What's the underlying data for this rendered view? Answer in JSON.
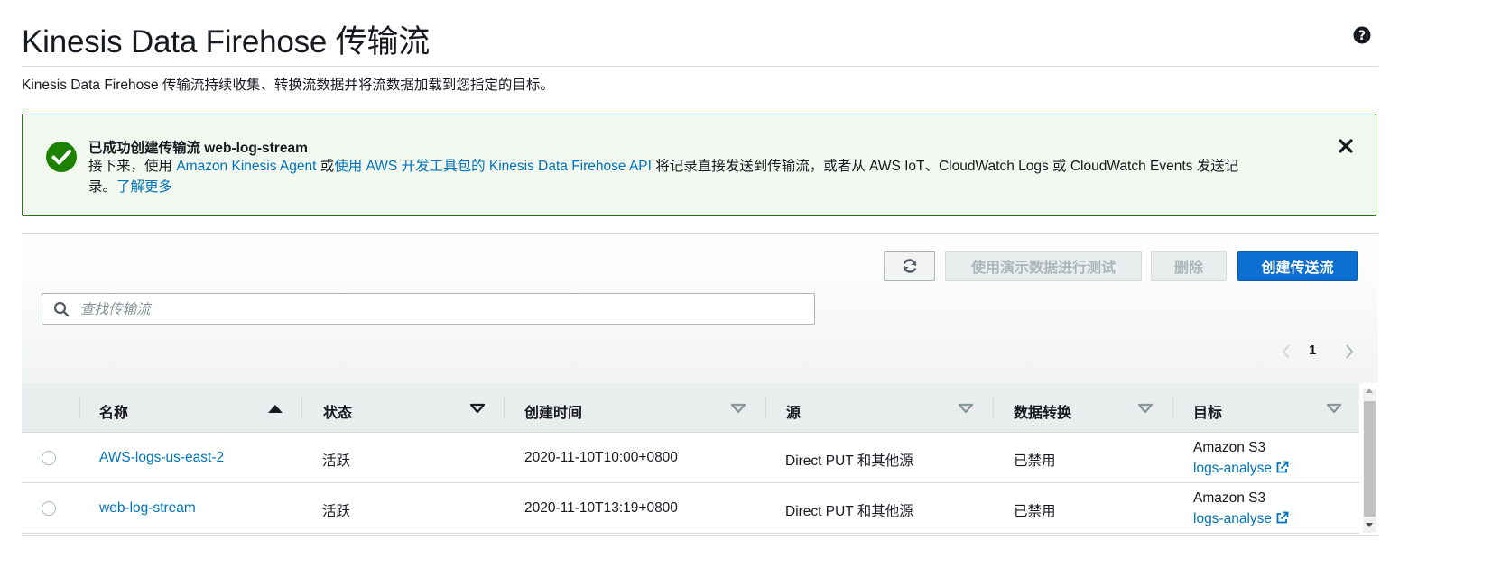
{
  "page": {
    "title": "Kinesis Data Firehose 传输流",
    "description": "Kinesis Data Firehose 传输流持续收集、转换流数据并将流数据加载到您指定的目标。",
    "help_icon": "help-circle-icon"
  },
  "flash": {
    "status_color": "#1d8102",
    "icon": "check-circle-icon",
    "title": "已成功创建传输流 web-log-stream",
    "body_prefix": "接下来，使用 ",
    "link_agent": "Amazon Kinesis Agent",
    "body_mid": " 或",
    "link_sdk": "使用 AWS 开发工具包的 Kinesis Data Firehose API",
    "body_suffix": " 将记录直接发送到传输流，或者从 AWS IoT、CloudWatch Logs 或 CloudWatch Events 发送记录。",
    "link_learn_more": "了解更多",
    "close_icon": "close-icon"
  },
  "toolbar": {
    "refresh_icon": "refresh-icon",
    "test_label": "使用演示数据进行测试",
    "delete_label": "删除",
    "create_label": "创建传送流",
    "primary_color": "#0a6fd0"
  },
  "search": {
    "placeholder": "查找传输流",
    "value": ""
  },
  "pagination": {
    "current_page": "1"
  },
  "table": {
    "columns": [
      {
        "label": "名称",
        "sort": "ascending"
      },
      {
        "label": "状态",
        "sort": "none"
      },
      {
        "label": "创建时间",
        "sort": "none"
      },
      {
        "label": "源",
        "sort": "none"
      },
      {
        "label": "数据转换",
        "sort": "none"
      },
      {
        "label": "目标",
        "sort": "none"
      }
    ],
    "rows": [
      {
        "name": "AWS-logs-us-east-2",
        "status": "活跃",
        "created": "2020-11-10T10:00+0800",
        "source": "Direct PUT 和其他源",
        "transform": "已禁用",
        "dest_type": "Amazon S3",
        "dest_link": "logs-analyse"
      },
      {
        "name": "web-log-stream",
        "status": "活跃",
        "created": "2020-11-10T13:19+0800",
        "source": "Direct PUT 和其他源",
        "transform": "已禁用",
        "dest_type": "Amazon S3",
        "dest_link": "logs-analyse"
      }
    ]
  }
}
